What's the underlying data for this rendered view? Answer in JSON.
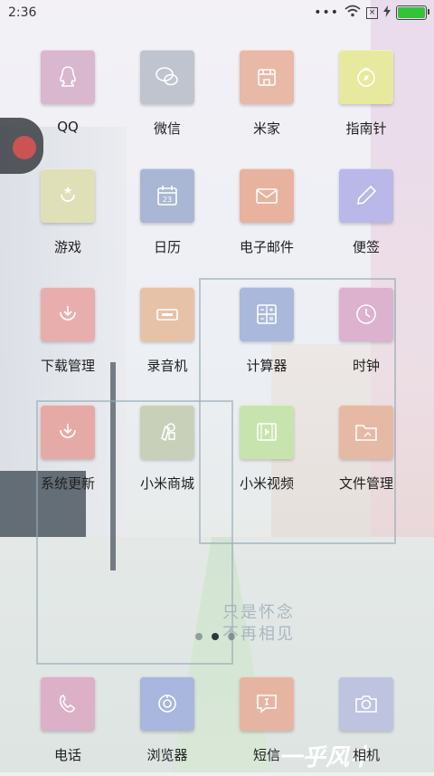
{
  "status_bar": {
    "time": "2:36",
    "more": "•••",
    "battery_level": 1.0
  },
  "wallpaper": {
    "line1": "只是怀念",
    "line2": "不再相见",
    "signature": "一乎风中"
  },
  "apps": [
    {
      "label": "QQ",
      "icon": "penguin-icon",
      "color": "#d9b7cf"
    },
    {
      "label": "微信",
      "icon": "chat-icon",
      "color": "#bfc4cf"
    },
    {
      "label": "米家",
      "icon": "home-store-icon",
      "color": "#e8b9a6"
    },
    {
      "label": "指南针",
      "icon": "compass-icon",
      "color": "#e7ea9e"
    },
    {
      "label": "游戏",
      "icon": "game-icon",
      "color": "#dfe0b7"
    },
    {
      "label": "日历",
      "icon": "calendar-icon",
      "color": "#a9b7d4"
    },
    {
      "label": "电子邮件",
      "icon": "mail-icon",
      "color": "#e7b39f"
    },
    {
      "label": "便签",
      "icon": "pencil-icon",
      "color": "#b9b8e8"
    },
    {
      "label": "下载管理",
      "icon": "download-icon",
      "color": "#e8aeae"
    },
    {
      "label": "录音机",
      "icon": "recorder-icon",
      "color": "#e6c2a8"
    },
    {
      "label": "计算器",
      "icon": "calculator-icon",
      "color": "#aab8dc"
    },
    {
      "label": "时钟",
      "icon": "clock-icon",
      "color": "#dcb2cf"
    },
    {
      "label": "系统更新",
      "icon": "update-icon",
      "color": "#e6aaa6"
    },
    {
      "label": "小米商城",
      "icon": "shop-icon",
      "color": "#c9d0ba"
    },
    {
      "label": "小米视频",
      "icon": "video-icon",
      "color": "#c8e4ae"
    },
    {
      "label": "文件管理",
      "icon": "folder-icon",
      "color": "#e6b9a4"
    }
  ],
  "dock": [
    {
      "label": "电话",
      "icon": "phone-icon",
      "color": "#dcb0c6"
    },
    {
      "label": "浏览器",
      "icon": "browser-icon",
      "color": "#a9b6dd"
    },
    {
      "label": "短信",
      "icon": "message-icon",
      "color": "#e6b5a2"
    },
    {
      "label": "相机",
      "icon": "camera-icon",
      "color": "#bec3df"
    }
  ],
  "page_indicator": {
    "pages": 3,
    "active": 2
  }
}
